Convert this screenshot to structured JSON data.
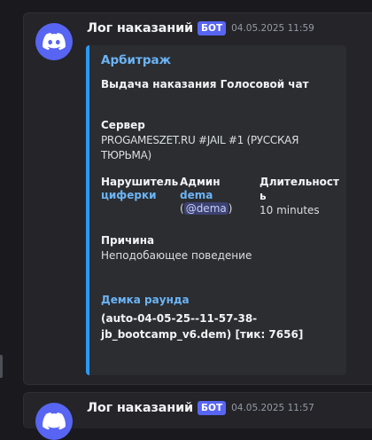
{
  "messages": [
    {
      "username": "Лог наказаний",
      "badge": "БОТ",
      "timestamp": "04.05.2025 11:59",
      "embed": {
        "title": "Арбитраж",
        "description": "Выдача наказания Голосовой чат",
        "server": {
          "name": "Сервер",
          "value": "PROGAMESZET.RU #JAIL #1 (РУССКАЯ ТЮРЬМА)"
        },
        "offender": {
          "name": "Нарушитель",
          "value": "циферки"
        },
        "admin": {
          "name": "Админ",
          "value": "dema",
          "mention": "@dema"
        },
        "duration": {
          "name": "Длительность",
          "value": "10 minutes"
        },
        "reason": {
          "name": "Причина",
          "value": "Неподобающее поведение"
        },
        "demo": {
          "name": "Демка раунда",
          "value_line1": "(auto-04-05-25--11-57-38-",
          "value_line2": "jb_bootcamp_v6.dem) [тик: 7656]"
        },
        "accent_color": "#2b9af3"
      }
    },
    {
      "username": "Лог наказаний",
      "badge": "БОТ",
      "timestamp": "04.05.2025 11:57"
    }
  ],
  "icons": {
    "avatar": "discord-logo-icon"
  },
  "colors": {
    "background": "#1a1a1e",
    "message": "#242429",
    "embed": "#2b2d31",
    "blurple": "#5865f2",
    "link": "#6cb4f5"
  }
}
